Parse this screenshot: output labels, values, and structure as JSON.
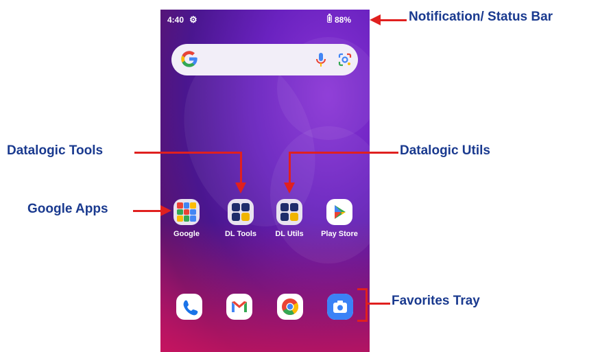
{
  "status_bar": {
    "time": "4:40",
    "battery": "88%"
  },
  "home_apps": [
    {
      "label": "Google"
    },
    {
      "label": "DL Tools"
    },
    {
      "label": "DL Utils"
    },
    {
      "label": "Play Store"
    }
  ],
  "dock_apps": [
    "phone-icon",
    "gmail-icon",
    "chrome-icon",
    "camera-icon"
  ],
  "annotations": {
    "status_bar": "Notification/ Status Bar",
    "datalogic_tools": "Datalogic Tools",
    "datalogic_utils": "Datalogic Utils",
    "google_apps": "Google Apps",
    "favorites_tray": "Favorites Tray"
  },
  "colors": {
    "annotation_text": "#1a3a8f",
    "arrow": "#e0201f",
    "wallpaper": "#6a22c0"
  }
}
